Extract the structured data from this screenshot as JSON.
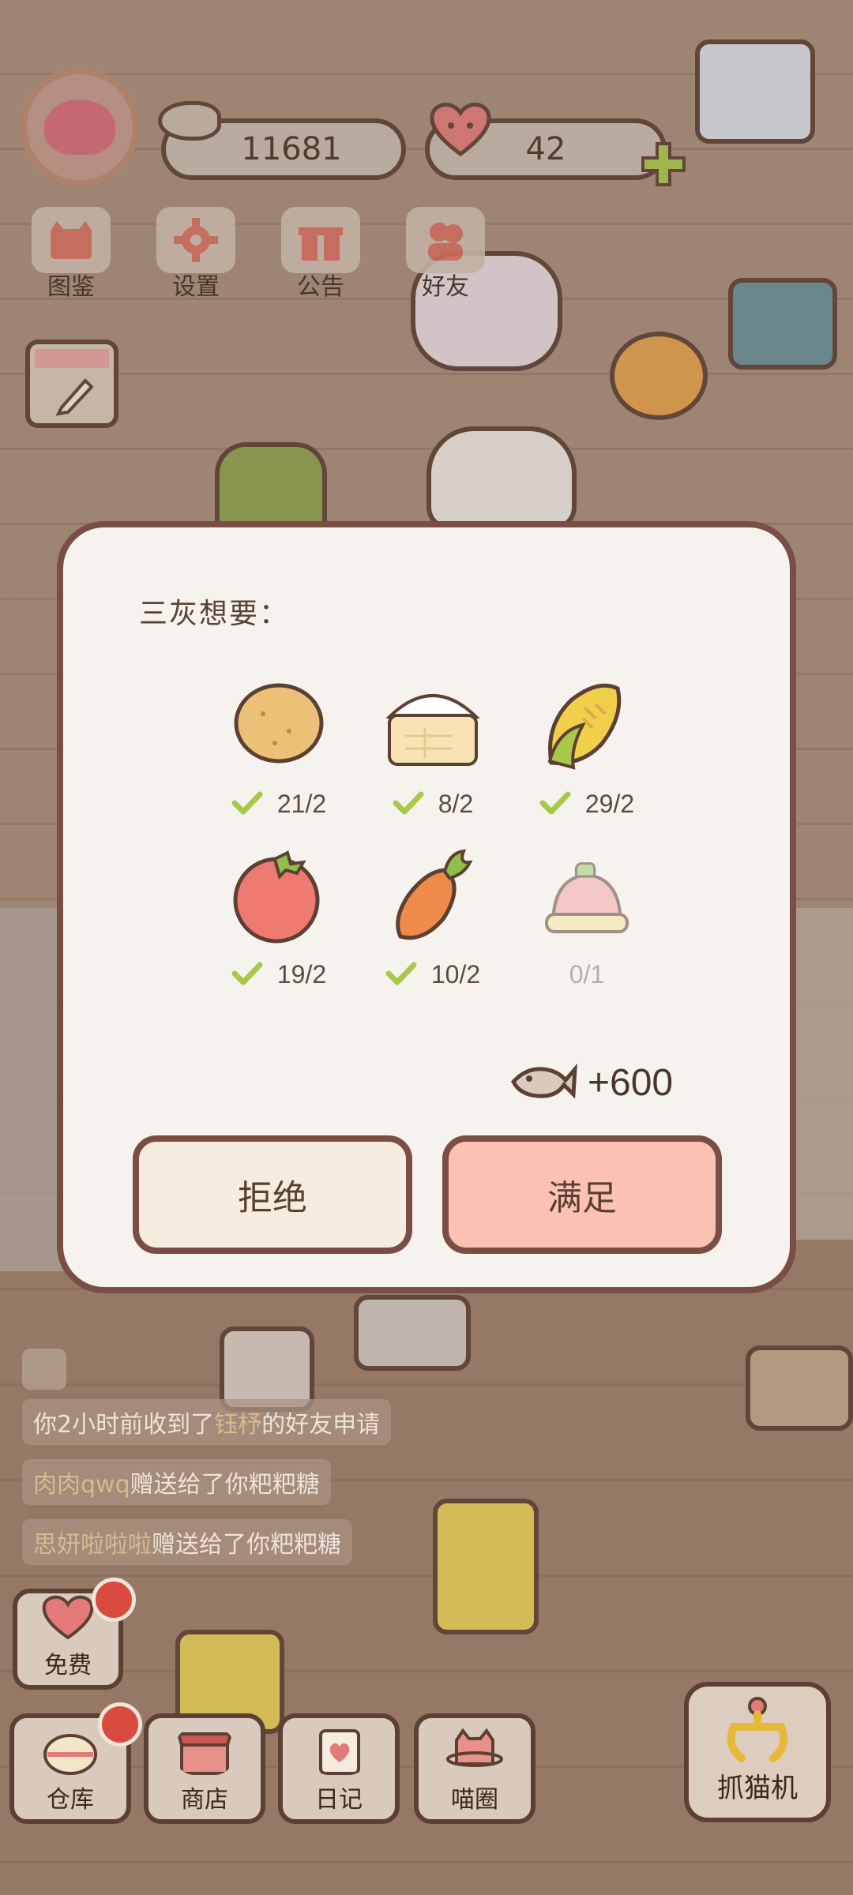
{
  "hud": {
    "fish_currency": "11681",
    "heart_currency": "42",
    "menu": [
      {
        "label": "图鉴",
        "icon": "cat-book-icon"
      },
      {
        "label": "设置",
        "icon": "gear-icon"
      },
      {
        "label": "公告",
        "icon": "gift-icon"
      },
      {
        "label": "好友",
        "icon": "friends-icon"
      }
    ]
  },
  "dialog": {
    "title": "三灰想要：",
    "items": [
      {
        "icon": "potato-icon",
        "count": "21/2",
        "fulfilled": true
      },
      {
        "icon": "rice-bun-icon",
        "count": "8/2",
        "fulfilled": true
      },
      {
        "icon": "corn-icon",
        "count": "29/2",
        "fulfilled": true
      },
      {
        "icon": "tomato-icon",
        "count": "19/2",
        "fulfilled": true
      },
      {
        "icon": "carrot-icon",
        "count": "10/2",
        "fulfilled": true
      },
      {
        "icon": "pudding-icon",
        "count": "0/1",
        "fulfilled": false
      }
    ],
    "reward": "+600",
    "reject_label": "拒绝",
    "accept_label": "满足"
  },
  "notifications": [
    {
      "prefix": "你2小时前收到了",
      "highlight": "钰杼",
      "suffix": "的好友申请"
    },
    {
      "prefix": "",
      "highlight": "肉肉qwq",
      "suffix": "赠送给了你粑粑糖"
    },
    {
      "prefix": "",
      "highlight": "思妍啦啦啦",
      "suffix": "赠送给了你粑粑糖"
    }
  ],
  "bottom_nav": {
    "free_label": "免费",
    "warehouse_label": "仓库",
    "shop_label": "商店",
    "diary_label": "日记",
    "circle_label": "喵圈",
    "claw_label": "抓猫机"
  },
  "colors": {
    "accept_button": "#fbc2b4",
    "reject_button": "#f3ecdf",
    "dialog_border": "#7a4e44",
    "check_green": "#a8c84a",
    "badge_red": "#d94a3f"
  }
}
